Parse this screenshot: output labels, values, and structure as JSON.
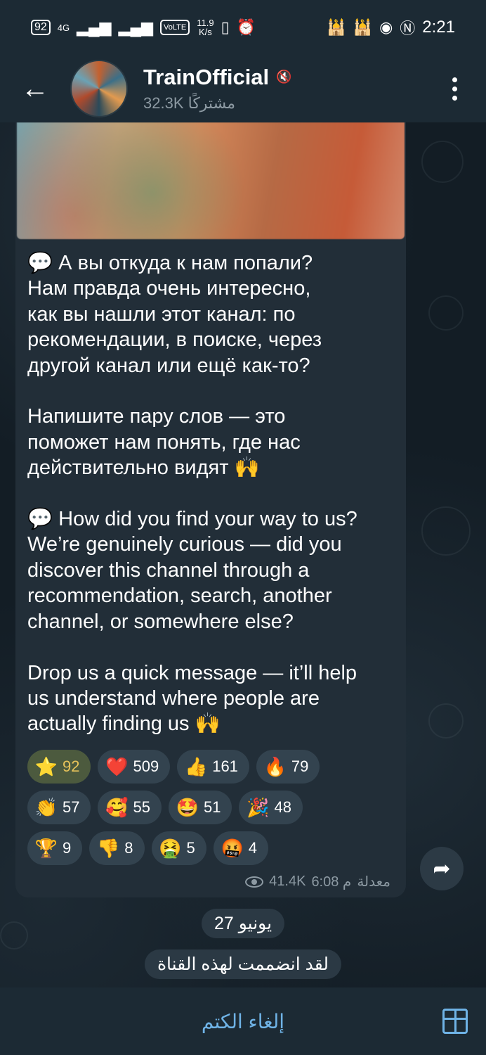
{
  "status_bar": {
    "battery": "92",
    "network_speed_value": "11.9",
    "network_speed_unit": "K/s",
    "signal_1": "4G",
    "volte": "VoLTE",
    "time": "2:21"
  },
  "header": {
    "channel_name": "TrainOfficial",
    "subscribers": "32.3K مشتركًا"
  },
  "message": {
    "text": "💬 А вы откуда к нам попали?\nНам правда очень интересно,\nкак вы нашли этот канал: по\nрекомендации, в поиске, через\nдругой канал или ещё как-то?\n\nНапишите пару слов — это\nпоможет нам понять, где нас\nдействительно видят 🙌\n\n💬 How did you find your way to us?\nWe’re genuinely curious — did you\ndiscover this channel through a\nrecommendation, search, another\nchannel, or somewhere else?\n\nDrop us a quick message — it’ll help\nus understand where people are\nactually finding us 🙌",
    "edited_label": "معدلة",
    "time": "6:08 م",
    "views": "41.4K"
  },
  "reactions": {
    "row1": [
      {
        "emoji": "⭐",
        "count": "92"
      },
      {
        "emoji": "❤️",
        "count": "509"
      },
      {
        "emoji": "👍",
        "count": "161"
      },
      {
        "emoji": "🔥",
        "count": "79"
      }
    ],
    "row2": [
      {
        "emoji": "👏",
        "count": "57"
      },
      {
        "emoji": "🥰",
        "count": "55"
      },
      {
        "emoji": "🤩",
        "count": "51"
      },
      {
        "emoji": "🎉",
        "count": "48"
      }
    ],
    "row3": [
      {
        "emoji": "🏆",
        "count": "9"
      },
      {
        "emoji": "👎",
        "count": "8"
      },
      {
        "emoji": "🤮",
        "count": "5"
      },
      {
        "emoji": "🤬",
        "count": "4"
      }
    ]
  },
  "date_pill": "27 يونيو",
  "joined_pill": "لقد انضممت لهذه القناة",
  "bottom": {
    "unmute_label": "إلغاء الكتم"
  }
}
